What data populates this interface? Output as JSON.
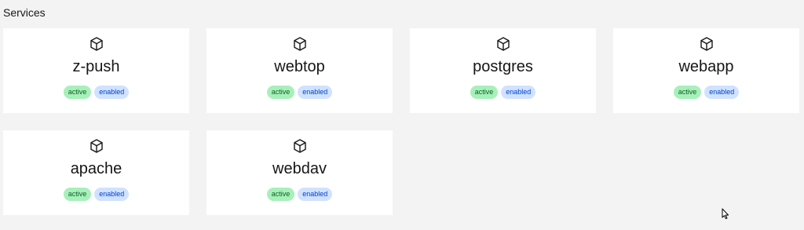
{
  "section": {
    "title": "Services"
  },
  "services": [
    {
      "name": "z-push",
      "status": "active",
      "state": "enabled",
      "icon": "cube-icon"
    },
    {
      "name": "webtop",
      "status": "active",
      "state": "enabled",
      "icon": "cube-icon"
    },
    {
      "name": "postgres",
      "status": "active",
      "state": "enabled",
      "icon": "cube-icon"
    },
    {
      "name": "webapp",
      "status": "active",
      "state": "enabled",
      "icon": "cube-icon"
    },
    {
      "name": "apache",
      "status": "active",
      "state": "enabled",
      "icon": "cube-icon"
    },
    {
      "name": "webdav",
      "status": "active",
      "state": "enabled",
      "icon": "cube-icon"
    }
  ],
  "colors": {
    "page_background": "#f3f3f3",
    "card_background": "#ffffff",
    "active_tag_bg": "#a7f0ba",
    "active_tag_text": "#0e6027",
    "enabled_tag_bg": "#d0e2ff",
    "enabled_tag_text": "#0043ce"
  }
}
